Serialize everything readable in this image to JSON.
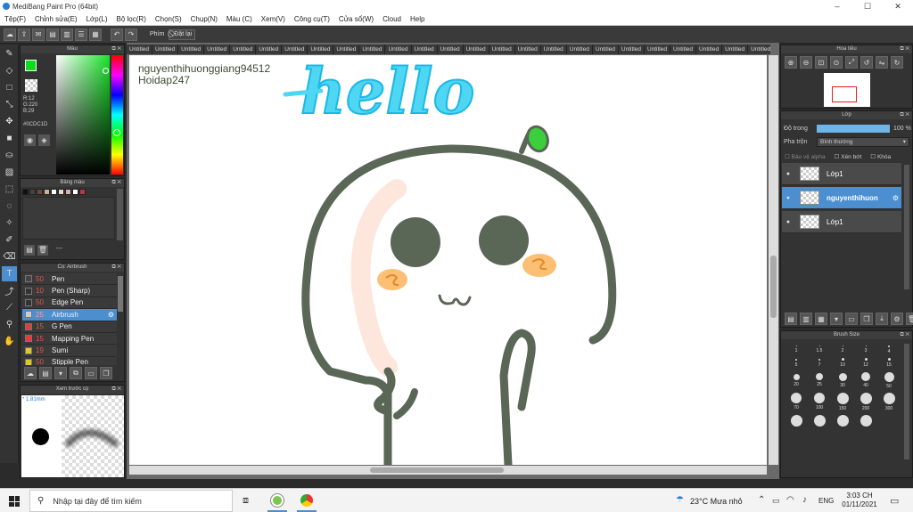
{
  "app": {
    "title": "MediBang Paint Pro (64bit)",
    "window_controls": [
      "–",
      "☐",
      "✕"
    ]
  },
  "menu": [
    "Tệp(F)",
    "Chỉnh sửa(E)",
    "Lớp(L)",
    "Bộ lọc(R)",
    "Chọn(S)",
    "Chụp(N)",
    "Màu (C)",
    "Xem(V)",
    "Công cụ(T)",
    "Cửa sổ(W)",
    "Cloud",
    "Help"
  ],
  "toolbar": {
    "shortcut_label": "Phím",
    "reset_label": "Đặt lại"
  },
  "tabs": [
    "Untitled",
    "Untitled",
    "Untitled",
    "Untitled",
    "Untitled",
    "Untitled",
    "Untitled",
    "Untitled",
    "Untitled",
    "Untitled",
    "Untitled",
    "Untitled",
    "Untitled",
    "Untitled",
    "Untitled",
    "Untitled",
    "Untitled",
    "Untitled",
    "Untitled",
    "Untitled",
    "Untitled",
    "Untitled",
    "Untitled",
    "Untitled",
    "Untitled",
    "Untitled",
    "Untitled",
    "Untitled",
    "Untitled",
    "Untitled",
    "Untitled",
    "Untitled"
  ],
  "color_panel": {
    "title": "Màu",
    "r": "R:12",
    "g": "G:220",
    "b": "B:29",
    "hex": "#0CDC1D",
    "foreground": "#0CDC1D"
  },
  "palette_panel": {
    "title": "Bảng màu",
    "swatches": [
      "#111111",
      "#444444",
      "#6b4a3a",
      "#c9b09a",
      "#ffffff",
      "#e9d9c9",
      "#d8b0b0",
      "#ffffff",
      "#b03a4a"
    ],
    "footer_text": "---"
  },
  "brush_panel": {
    "title": "Cọ: Airbrush",
    "items": [
      {
        "size": "50",
        "name": "Pen",
        "color": "#444444"
      },
      {
        "size": "10",
        "name": "Pen (Sharp)",
        "color": "#333333"
      },
      {
        "size": "50",
        "name": "Edge Pen",
        "color": "#333333"
      },
      {
        "size": "25",
        "name": "Airbrush",
        "color": "#cccccc"
      },
      {
        "size": "15",
        "name": "G Pen",
        "color": "#e23c3c"
      },
      {
        "size": "15",
        "name": "Mapping Pen",
        "color": "#e23c3c"
      },
      {
        "size": "19",
        "name": "Sumi",
        "color": "#e2c52a"
      },
      {
        "size": "50",
        "name": "Stipple Pen",
        "color": "#e2c52a"
      }
    ]
  },
  "preview_panel": {
    "title": "Xem trước cọ",
    "size_label": "* 1.81mm"
  },
  "canvas": {
    "username": "nguyenthihuonggiang94512",
    "site": "Hoidap247",
    "hello": "hello"
  },
  "navigator": {
    "title": "Hoa tiêu"
  },
  "layer_panel": {
    "title": "Lớp",
    "opacity_label": "Độ trong",
    "opacity_value": "100 %",
    "opacity_fraction": 1.0,
    "blend_label": "Pha trộn",
    "blend_value": "Bình thường",
    "protect_alpha": "Bảo vệ alpha",
    "clip": "Xén bớt",
    "lock": "Khóa",
    "layers": [
      {
        "name": "Lớp1",
        "selected": false
      },
      {
        "name": "nguyenthihuon",
        "selected": true
      },
      {
        "name": "Lớp1",
        "selected": false
      }
    ]
  },
  "brush_size": {
    "title": "Brush Size",
    "rows": [
      [
        "1",
        "1.5",
        "2",
        "3",
        "4"
      ],
      [
        "5",
        "7",
        "10",
        "12",
        "15"
      ],
      [
        "20",
        "25",
        "30",
        "40",
        "50"
      ],
      [
        "70",
        "100",
        "150",
        "200",
        "300"
      ],
      [
        "",
        "",
        "",
        ""
      ]
    ]
  },
  "taskbar": {
    "search_placeholder": "Nhập tại đây để tìm kiếm",
    "weather": "23°C  Mưa nhỏ",
    "language": "ENG",
    "time": "3:03 CH",
    "date": "01/11/2021"
  }
}
